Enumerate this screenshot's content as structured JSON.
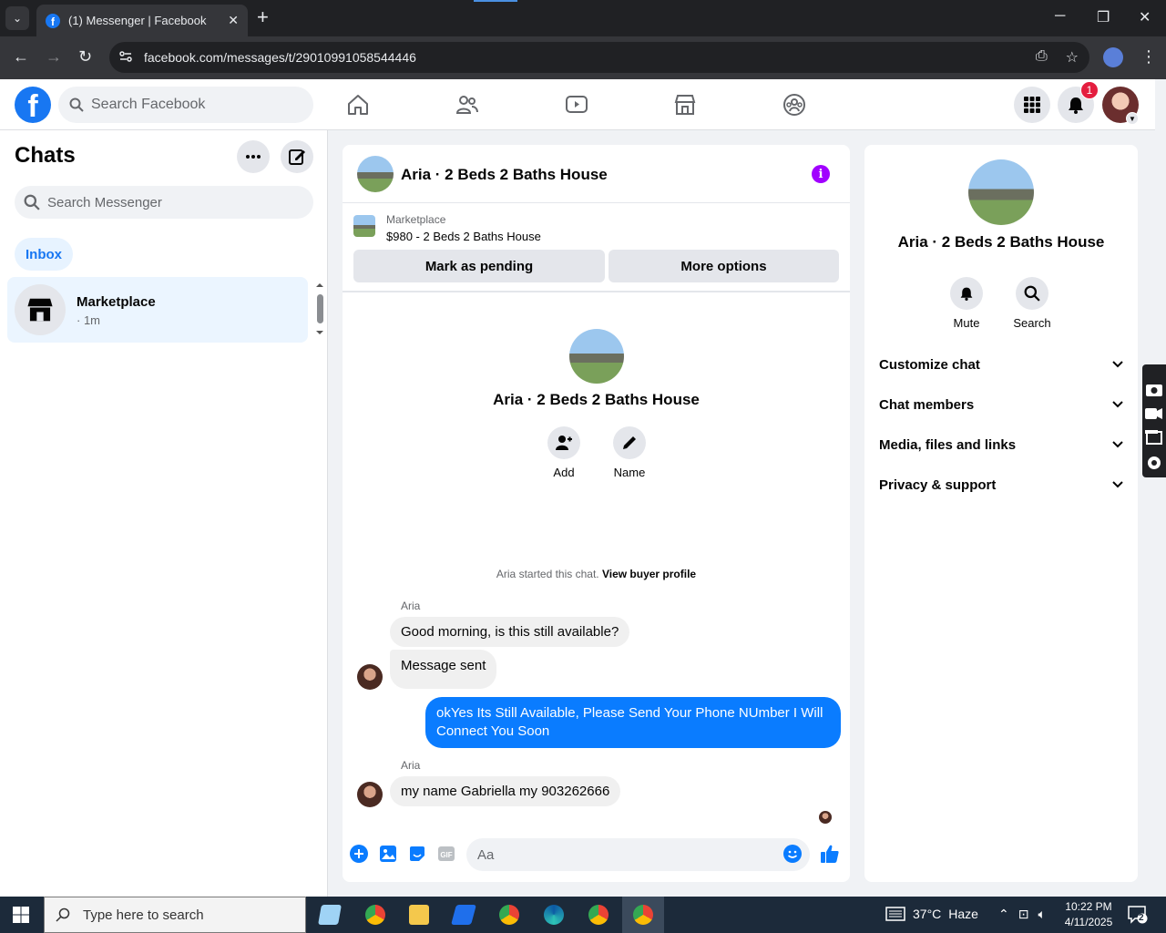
{
  "browser": {
    "tab_title": "(1) Messenger | Facebook",
    "url": "facebook.com/messages/t/29010991058544446",
    "new_tab": "+",
    "tab_close": "✕"
  },
  "fb_header": {
    "search_placeholder": "Search Facebook",
    "notification_count": "1"
  },
  "left_panel": {
    "title": "Chats",
    "search_placeholder": "Search Messenger",
    "inbox_label": "Inbox",
    "chats": [
      {
        "name": "Marketplace",
        "time": "· 1m"
      }
    ]
  },
  "conversation": {
    "title": "Aria · 2 Beds 2 Baths House",
    "marketplace_label": "Marketplace",
    "listing": "$980 - 2 Beds 2 Baths House",
    "mark_pending": "Mark as pending",
    "more_options": "More options",
    "intro_title": "Aria · 2 Beds 2 Baths House",
    "intro_actions": {
      "add": "Add",
      "name": "Name"
    },
    "started_text": "Aria started this chat.",
    "view_profile": "View buyer profile",
    "messages": [
      {
        "sender": "Aria",
        "text": "Good morning, is this still available?"
      },
      {
        "text": "Message sent"
      },
      {
        "text": "okYes Its Still Available, Please Send Your Phone NUmber I Will Connect You Soon"
      },
      {
        "sender": "Aria",
        "text": "my name Gabriella my 903262666"
      }
    ],
    "composer_placeholder": "Aa"
  },
  "right_panel": {
    "title": "Aria · 2 Beds 2 Baths House",
    "actions": {
      "mute": "Mute",
      "search": "Search"
    },
    "sections": [
      "Customize chat",
      "Chat members",
      "Media, files and links",
      "Privacy & support"
    ]
  },
  "taskbar": {
    "search_placeholder": "Type here to search",
    "weather_temp": "37°C",
    "weather_desc": "Haze",
    "time": "10:22 PM",
    "date": "4/11/2025",
    "notif_count": "2"
  },
  "colors": {
    "fb_blue": "#1877f2",
    "outgoing_bubble": "#0a7cff",
    "info_purple": "#a100ff",
    "badge_red": "#e41e3f"
  }
}
